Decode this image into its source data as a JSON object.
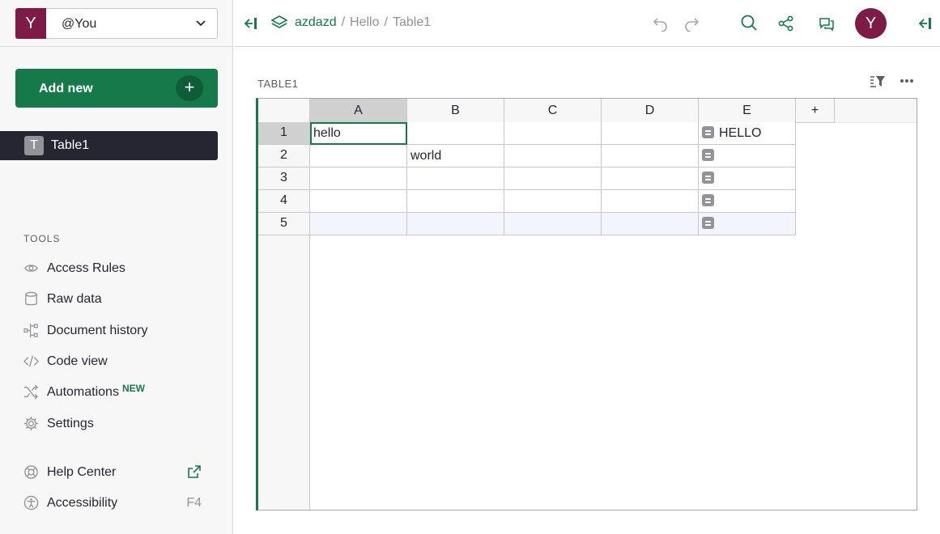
{
  "org": {
    "avatar_letter": "Y",
    "name": "@You"
  },
  "add_new_label": "Add new",
  "pages": [
    {
      "icon_letter": "T",
      "label": "Table1"
    }
  ],
  "tools": {
    "title": "TOOLS",
    "items": [
      {
        "label": "Access Rules",
        "icon": "eye-icon"
      },
      {
        "label": "Raw data",
        "icon": "database-icon"
      },
      {
        "label": "Document history",
        "icon": "history-icon"
      },
      {
        "label": "Code view",
        "icon": "code-icon"
      },
      {
        "label": "Automations",
        "icon": "shuffle-icon",
        "badge": "NEW"
      },
      {
        "label": "Settings",
        "icon": "gear-icon"
      }
    ]
  },
  "help": {
    "label": "Help Center"
  },
  "accessibility": {
    "label": "Accessibility",
    "shortcut": "F4"
  },
  "breadcrumb": {
    "workspace": "azdazd",
    "doc": "Hello",
    "page": "Table1",
    "separator": "/"
  },
  "user_avatar_letter": "Y",
  "section_title": "TABLE1",
  "grid": {
    "columns": [
      "A",
      "B",
      "C",
      "D",
      "E"
    ],
    "add_column_label": "+",
    "rows": [
      {
        "num": "1",
        "cells": [
          "hello",
          "",
          "",
          "",
          "HELLO"
        ]
      },
      {
        "num": "2",
        "cells": [
          "",
          "world",
          "",
          "",
          ""
        ]
      },
      {
        "num": "3",
        "cells": [
          "",
          "",
          "",
          "",
          ""
        ]
      },
      {
        "num": "4",
        "cells": [
          "",
          "",
          "",
          "",
          ""
        ]
      },
      {
        "num": "5",
        "cells": [
          "",
          "",
          "",
          "",
          ""
        ]
      }
    ]
  },
  "colors": {
    "accent": "#16794a",
    "avatar": "#7d1a45",
    "active_page": "#262633"
  }
}
